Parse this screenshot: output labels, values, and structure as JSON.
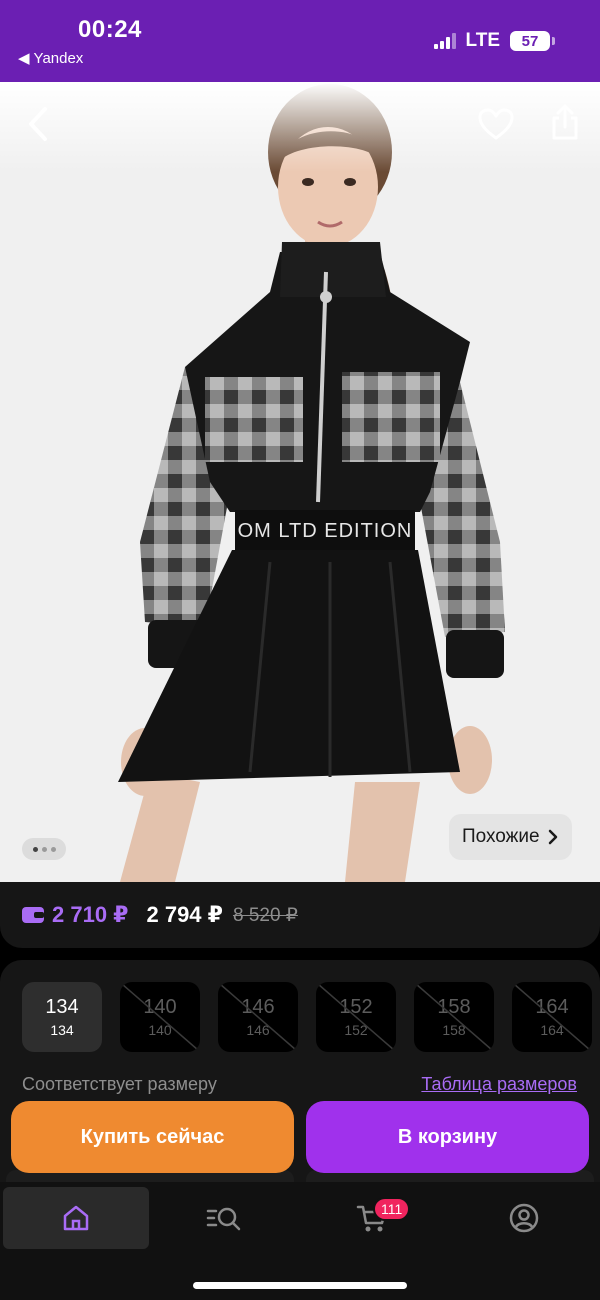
{
  "status_bar": {
    "time": "00:24",
    "back_app": "Yandex",
    "network": "LTE",
    "battery": "57"
  },
  "product": {
    "waistband_text": "OM LTD EDITION",
    "similar_label": "Похожие",
    "image_count": 3,
    "current_image": 1
  },
  "price": {
    "card_price": "2 710 ₽",
    "price": "2 794 ₽",
    "old_price": "8 520 ₽"
  },
  "sizes": {
    "items": [
      {
        "size": "134",
        "height": "134",
        "available": true,
        "selected": true
      },
      {
        "size": "140",
        "height": "140",
        "available": false,
        "selected": false
      },
      {
        "size": "146",
        "height": "146",
        "available": false,
        "selected": false
      },
      {
        "size": "152",
        "height": "152",
        "available": false,
        "selected": false
      },
      {
        "size": "158",
        "height": "158",
        "available": false,
        "selected": false
      },
      {
        "size": "164",
        "height": "164",
        "available": false,
        "selected": false
      }
    ],
    "fit_text": "Соответствует размеру",
    "size_table_link": "Таблица размеров"
  },
  "actions": {
    "buy_now": "Купить сейчас",
    "add_to_cart": "В корзину"
  },
  "tabbar": {
    "cart_badge": "111"
  },
  "colors": {
    "status_bar": "#6b1fb3",
    "accent_purple": "#a031ec",
    "price_purple": "#a96cf5",
    "buy_orange": "#ef8a30",
    "badge_pink": "#f0245e"
  }
}
